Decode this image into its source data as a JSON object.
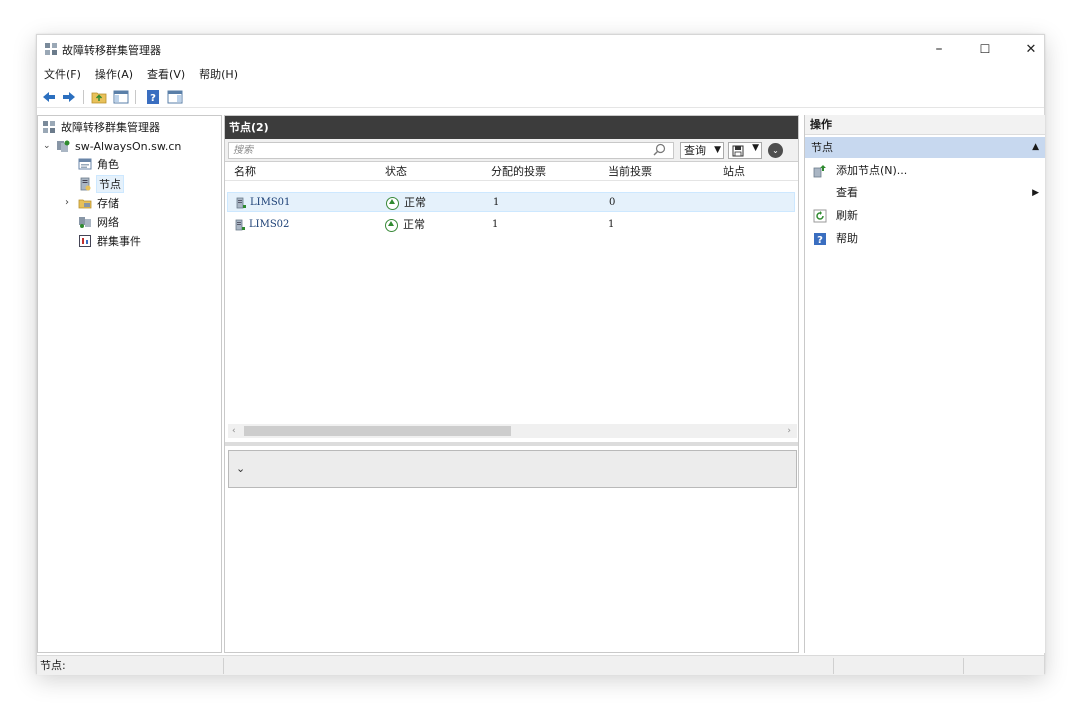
{
  "window": {
    "title": "故障转移群集管理器",
    "minimize": "–",
    "maximize": "☐",
    "close": "✕"
  },
  "menu": [
    "文件(F)",
    "操作(A)",
    "查看(V)",
    "帮助(H)"
  ],
  "tree": {
    "root": "故障转移群集管理器",
    "cluster": "sw-AlwaysOn.sw.cn",
    "items": [
      "角色",
      "节点",
      "存储",
      "网络",
      "群集事件"
    ],
    "selected_index": 1
  },
  "center": {
    "title": "节点(2)",
    "search_placeholder": "搜索",
    "query_label": "查询",
    "columns": [
      "名称",
      "状态",
      "分配的投票",
      "当前投票",
      "站点"
    ],
    "rows": [
      {
        "name": "LIMS01",
        "status": "正常",
        "assigned_votes": "1",
        "current_votes": "0",
        "site": ""
      },
      {
        "name": "LIMS02",
        "status": "正常",
        "assigned_votes": "1",
        "current_votes": "1",
        "site": ""
      }
    ],
    "selected_row": 0
  },
  "actions": {
    "title": "操作",
    "section": "节点",
    "items": [
      {
        "label": "添加节点(N)...",
        "icon": "add-node-icon",
        "submenu": false
      },
      {
        "label": "查看",
        "icon": "",
        "submenu": true
      },
      {
        "label": "刷新",
        "icon": "refresh-icon",
        "submenu": false
      },
      {
        "label": "帮助",
        "icon": "help-icon",
        "submenu": false
      }
    ]
  },
  "status_bar": {
    "text": "节点:"
  },
  "colors": {
    "header_dark": "#3c3c3c",
    "section_blue": "#c7d8ef",
    "selection": "#e5f1fb",
    "status_green": "#2f8a2f"
  }
}
